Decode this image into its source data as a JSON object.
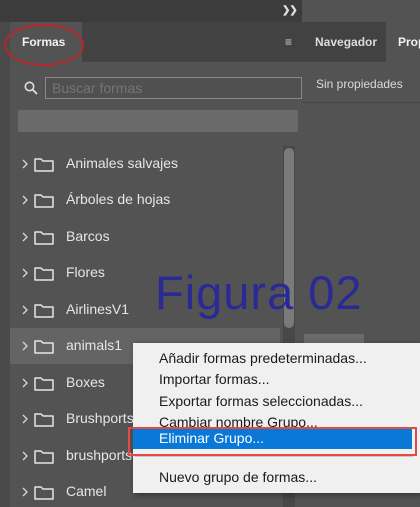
{
  "shapes_panel": {
    "tab_label": "Formas",
    "search_placeholder": "Buscar formas",
    "groups": [
      {
        "label": "Animales salvajes"
      },
      {
        "label": "Árboles de hojas"
      },
      {
        "label": "Barcos"
      },
      {
        "label": "Flores"
      },
      {
        "label": "AirlinesV1"
      },
      {
        "label": "animals1",
        "selected": true
      },
      {
        "label": "Boxes"
      },
      {
        "label": "Brushports"
      },
      {
        "label": "brushports"
      },
      {
        "label": "Camel"
      }
    ]
  },
  "right_panel": {
    "tab_navigator": "Navegador",
    "tab_properties": "Propiedades",
    "empty_properties": "Sin propiedades"
  },
  "context_menu": {
    "items": [
      {
        "label": "Añadir formas predeterminadas..."
      },
      {
        "label": "Importar formas..."
      },
      {
        "label": "Exportar formas seleccionadas..."
      },
      {
        "label": "Cambiar nombre Grupo..."
      },
      {
        "label": "Eliminar Grupo...",
        "highlighted": true
      },
      {
        "label": "Nuevo grupo de formas..."
      }
    ]
  },
  "watermark": "Figura 02",
  "icons": {
    "panel_menu": "hamburger-menu-icon",
    "collapse": "double-chevron-right-icon",
    "search": "search-icon",
    "expand": "chevron-right-icon",
    "folder": "folder-icon"
  },
  "colors": {
    "highlight": "#0a78d7",
    "annotation_red": "#e34a45",
    "watermark": "#2a2a96"
  }
}
